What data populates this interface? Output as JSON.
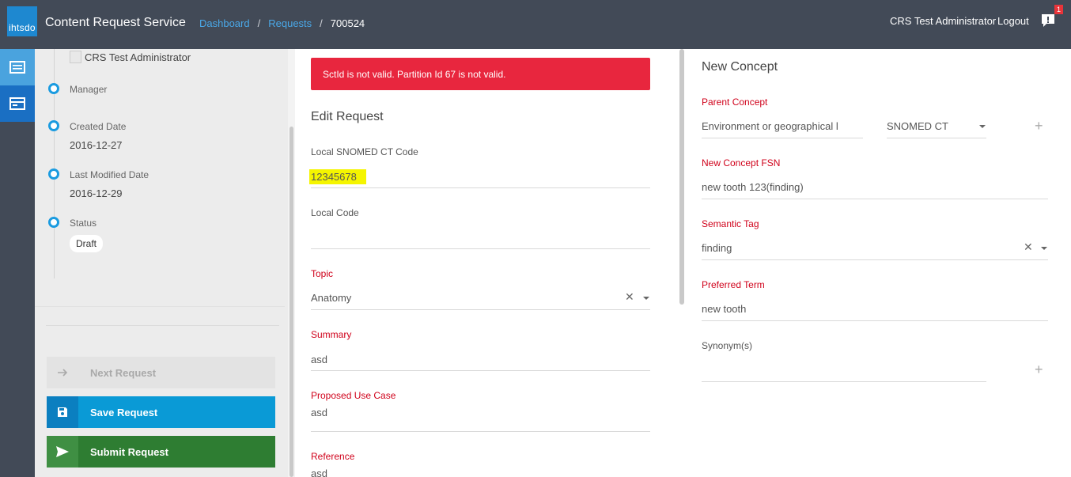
{
  "header": {
    "logo_text": "ihtsdo",
    "app_title": "Content Request Service",
    "breadcrumb": {
      "dashboard": "Dashboard",
      "requests": "Requests",
      "separator": "/",
      "current": "700524"
    },
    "user_name": "CRS Test Administrator",
    "logout_label": "Logout",
    "notification_count": "1"
  },
  "rail": {
    "items": [
      "list-icon",
      "card-icon"
    ]
  },
  "sidebar": {
    "owner_name": "CRS Test Administrator",
    "manager_label": "Manager",
    "created_date_label": "Created Date",
    "created_date": "2016-12-27",
    "last_modified_label": "Last Modified Date",
    "last_modified": "2016-12-29",
    "status_label": "Status",
    "status_value": "Draft",
    "next_request_label": "Next Request",
    "save_request_label": "Save Request",
    "submit_request_label": "Submit Request"
  },
  "form": {
    "error_message": "SctId is not valid. Partition Id 67 is not valid.",
    "title": "Edit Request",
    "local_snomed_label": "Local SNOMED CT Code",
    "local_snomed_value": "12345678",
    "local_code_label": "Local Code",
    "local_code_value": "",
    "topic_label": "Topic",
    "topic_value": "Anatomy",
    "summary_label": "Summary",
    "summary_value": "asd",
    "proposed_use_case_label": "Proposed Use Case",
    "proposed_use_case_value": "asd",
    "reference_label": "Reference",
    "reference_value": "asd"
  },
  "concept": {
    "title": "New Concept",
    "parent_concept_label": "Parent Concept",
    "parent_concept_value": "Environment or geographical l",
    "parent_concept_source": "SNOMED CT",
    "fsn_label": "New Concept FSN",
    "fsn_value": "new tooth 123(finding)",
    "semantic_tag_label": "Semantic Tag",
    "semantic_tag_value": "finding",
    "preferred_term_label": "Preferred Term",
    "preferred_term_value": "new tooth",
    "synonyms_label": "Synonym(s)",
    "synonyms_value": ""
  },
  "colors": {
    "topbar": "#424a57",
    "accent_blue": "#0a9ad6",
    "error_red": "#e8263e",
    "submit_green": "#2e7d32",
    "required_label": "#d0021b"
  }
}
